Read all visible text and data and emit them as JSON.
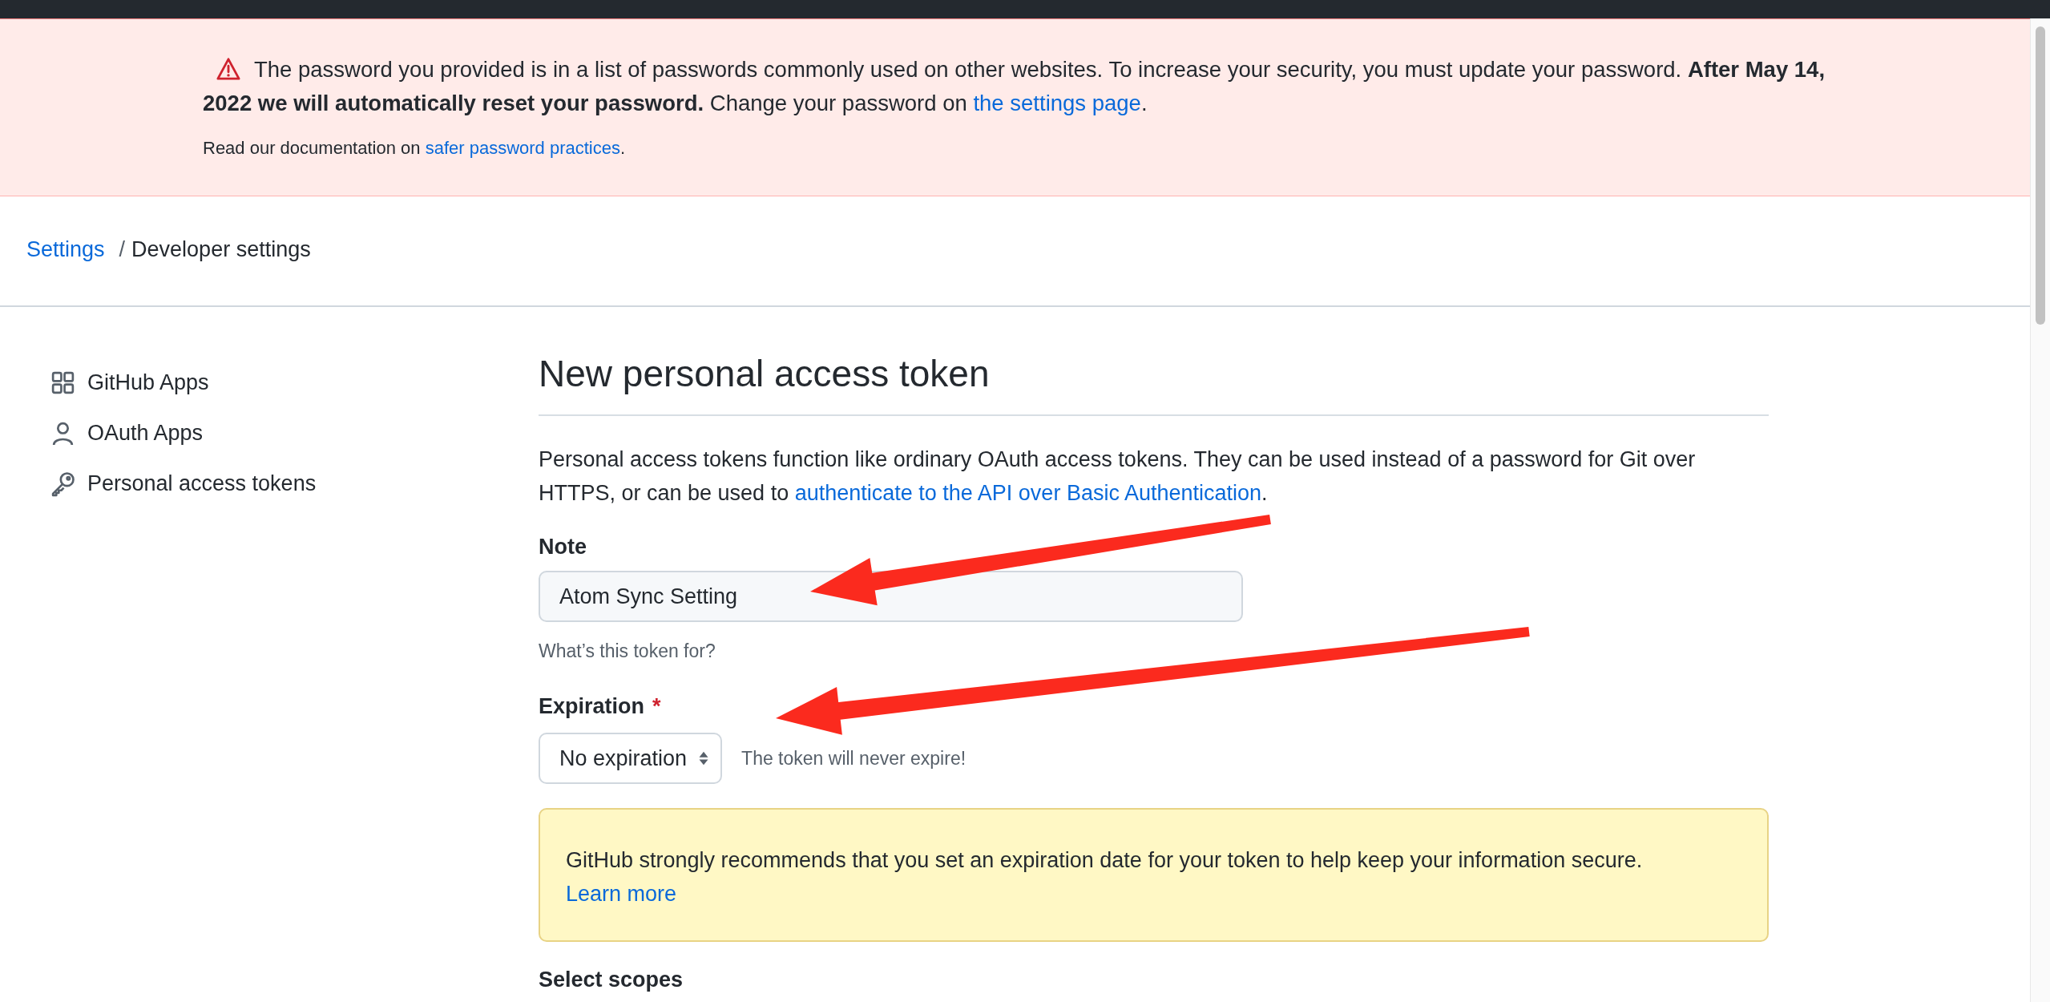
{
  "banner": {
    "message": "The password you provided is in a list of passwords commonly used on other websites. To increase your security, you must update your password. **After May 14, 2022 we will automatically reset your password.** Change your password on ",
    "link": "the settings page",
    "end": ".",
    "doc_text": "Read our documentation on ",
    "doc_link": "safer password practices",
    "doc_end": "."
  },
  "breadcrumb": {
    "items": [
      {
        "label": "Settings",
        "link": true
      },
      {
        "label": "Developer settings",
        "link": false
      }
    ],
    "separator": "/"
  },
  "sidebar": {
    "items": [
      {
        "label": "GitHub Apps"
      },
      {
        "label": "OAuth Apps"
      },
      {
        "label": "Personal access tokens"
      }
    ]
  },
  "form": {
    "heading": "New personal access token",
    "intro": "Personal access tokens function like ordinary OAuth access tokens. They can be used instead of a password for Git over HTTPS, or can be used to ",
    "intro_link": "authenticate to the API over Basic Authentication",
    "intro_end": ".",
    "note": {
      "label": "Note",
      "value": "Atom Sync Setting",
      "hint": "What’s this token for?"
    },
    "expiration": {
      "label": "Expiration",
      "required": "*",
      "value": "No expiration",
      "info": "The token will never expire!"
    },
    "callout": {
      "text": "GitHub strongly recommends that you set an expiration date for your token to help keep your information secure.",
      "link": "Learn more"
    },
    "scopes": {
      "label": "Select scopes"
    }
  }
}
